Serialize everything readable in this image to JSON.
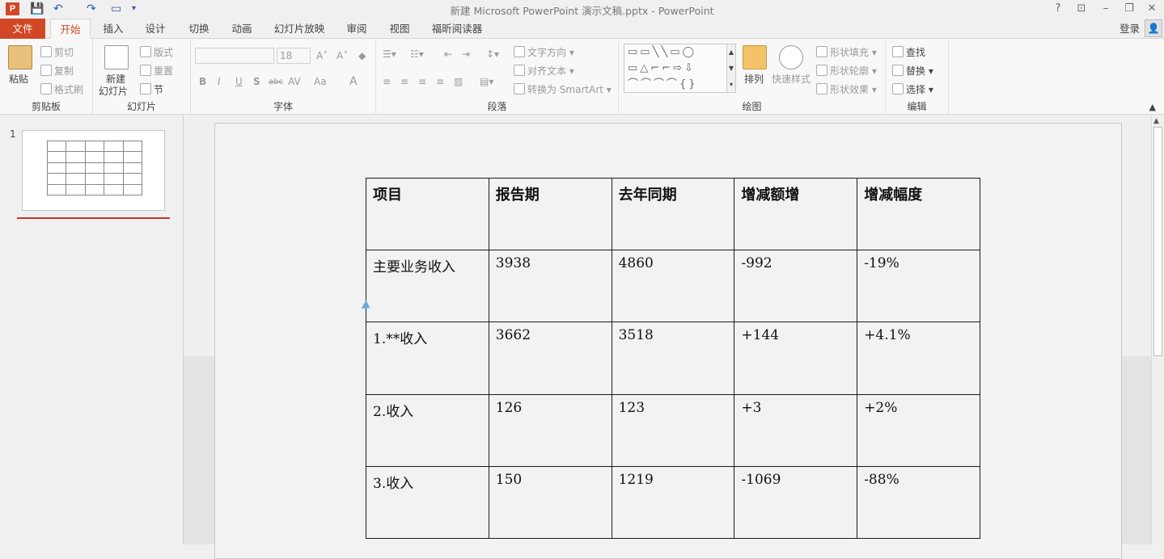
{
  "titlebar": {
    "window_title": "新建 Microsoft PowerPoint 演示文稿.pptx - PowerPoint",
    "app_logo": "P",
    "help": "?",
    "minimize": "–",
    "restore": "❐",
    "close": "✕"
  },
  "quick_access": {
    "save_icon": "💾",
    "undo_icon": "↶",
    "redo_icon": "↷",
    "present_icon": "▭",
    "more_icon": "▾"
  },
  "tabs": [
    "文件",
    "开始",
    "插入",
    "设计",
    "切换",
    "动画",
    "幻灯片放映",
    "审阅",
    "视图",
    "福昕阅读器"
  ],
  "account": {
    "login": "登录",
    "avatar": "👤"
  },
  "ribbon": {
    "clipboard": {
      "label": "剪贴板",
      "paste": "粘贴",
      "cut": "剪切",
      "copy": "复制",
      "format_painter": "格式刷"
    },
    "slides": {
      "label": "幻灯片",
      "new_slide_1": "新建",
      "new_slide_2": "幻灯片",
      "layout": "版式",
      "reset": "重置",
      "section": "节"
    },
    "font": {
      "label": "字体",
      "font_size": "18",
      "bold": "B",
      "italic": "I",
      "underline": "U",
      "shadow": "S",
      "strike": "abc",
      "spacing": "AV",
      "case": "Aa",
      "color": "A",
      "grow": "A˄",
      "shrink": "A˅",
      "clear": "◆"
    },
    "paragraph": {
      "label": "段落",
      "text_direction": "文字方向",
      "align_text": "对齐文本",
      "smartart": "转换为 SmartArt"
    },
    "drawing": {
      "label": "绘图",
      "arrange": "排列",
      "quick_styles": "快速样式",
      "shape_fill": "形状填充",
      "shape_outline": "形状轮廓",
      "shape_effects": "形状效果"
    },
    "editing": {
      "label": "编辑",
      "find": "查找",
      "replace": "替换",
      "select": "选择"
    }
  },
  "thumbnail": {
    "slide_number": "1"
  },
  "table": {
    "header": [
      "项目",
      "报告期",
      "去年同期",
      "增减额增",
      "增减幅度"
    ],
    "rows": [
      [
        "主要业务收入",
        "3938",
        "4860",
        "-992",
        "-19%"
      ],
      [
        "1.**收入",
        "3662",
        "3518",
        "+144",
        "+4.1%"
      ],
      [
        "2.收入",
        "126",
        "123",
        "+3",
        "+2%"
      ],
      [
        "3.收入",
        "150",
        "1219",
        "-1069",
        "-88%"
      ]
    ]
  }
}
